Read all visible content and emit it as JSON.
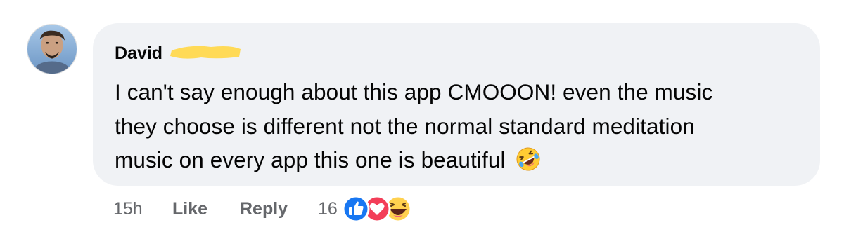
{
  "comment": {
    "author": "David",
    "lines": [
      "I can't say enough about this app CMOOON! even the music",
      "they choose is different not the normal standard meditation",
      "music on every app this one is beautiful"
    ],
    "trailing_emoji": "rolling-on-the-floor-laughing-emoji"
  },
  "actions": {
    "time": "15h",
    "like_label": "Like",
    "reply_label": "Reply",
    "reaction_count": "16",
    "reactions": [
      "like-reaction-icon",
      "love-reaction-icon",
      "haha-reaction-icon"
    ]
  },
  "colors": {
    "bubble_bg": "#f0f2f5",
    "meta_text": "#65676b",
    "like_blue": "#1877f2",
    "love_red": "#f33e58",
    "haha_yellow": "#f7b125",
    "redaction_highlight": "#ffd84d"
  }
}
